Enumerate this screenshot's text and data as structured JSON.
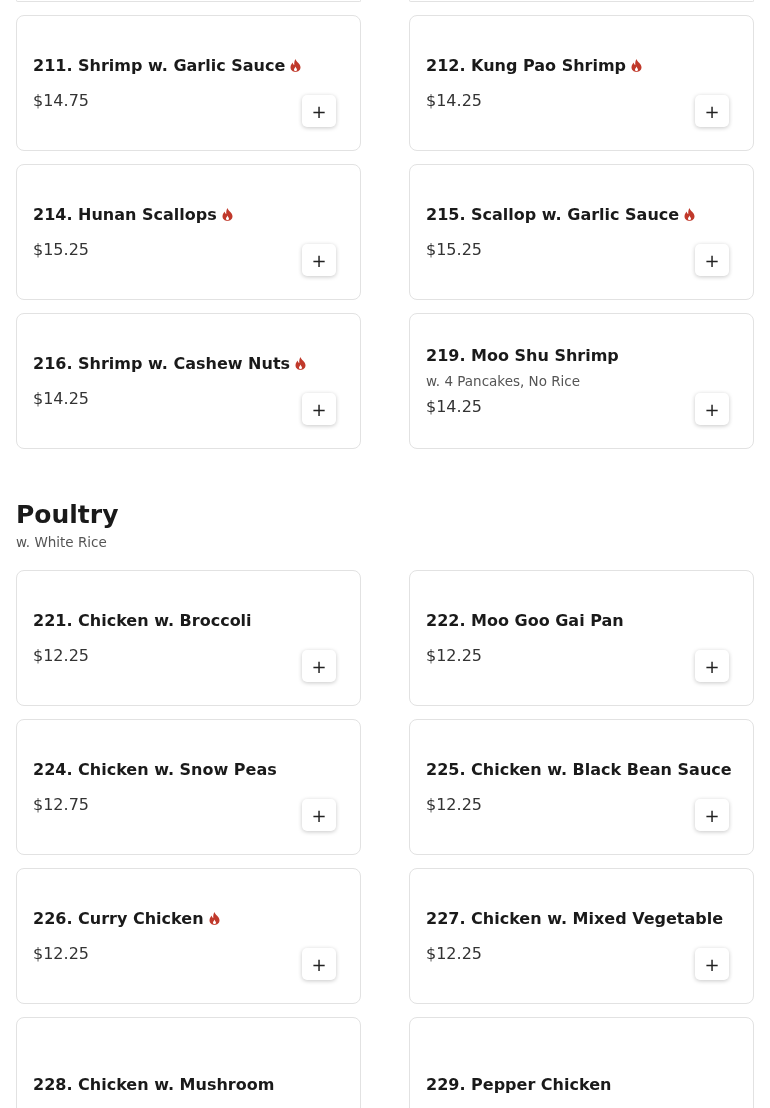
{
  "sections": [
    {
      "items": [
        {
          "name": "211. Shrimp w. Garlic Sauce",
          "spicy": true,
          "price": "$14.75",
          "button": "+"
        },
        {
          "name": "212. Kung Pao Shrimp",
          "spicy": true,
          "price": "$14.25",
          "button": "+"
        },
        {
          "name": "214. Hunan Scallops",
          "spicy": true,
          "price": "$15.25",
          "button": "+"
        },
        {
          "name": "215. Scallop w. Garlic Sauce",
          "spicy": true,
          "price": "$15.25",
          "button": "+"
        },
        {
          "name": "216. Shrimp w. Cashew Nuts",
          "spicy": true,
          "price": "$14.25",
          "button": "+"
        },
        {
          "name": "219. Moo Shu Shrimp",
          "spicy": false,
          "description": "w. 4 Pancakes, No Rice",
          "price": "$14.25",
          "button": "+"
        }
      ]
    },
    {
      "title": "Poultry",
      "subtitle": "w. White Rice",
      "items": [
        {
          "name": "221. Chicken w. Broccoli",
          "spicy": false,
          "price": "$12.25",
          "button": "+"
        },
        {
          "name": "222. Moo Goo Gai Pan",
          "spicy": false,
          "price": "$12.25",
          "button": "+"
        },
        {
          "name": "224. Chicken w. Snow Peas",
          "spicy": false,
          "price": "$12.75",
          "button": "+"
        },
        {
          "name": "225. Chicken w. Black Bean Sauce",
          "spicy": false,
          "price": "$12.25",
          "button": "+"
        },
        {
          "name": "226. Curry Chicken",
          "spicy": true,
          "price": "$12.25",
          "button": "+"
        },
        {
          "name": "227. Chicken w. Mixed Vegetable",
          "spicy": false,
          "price": "$12.25",
          "button": "+"
        },
        {
          "name": "228. Chicken w. Mushroom",
          "spicy": false
        },
        {
          "name": "229. Pepper Chicken",
          "spicy": false
        }
      ]
    }
  ]
}
